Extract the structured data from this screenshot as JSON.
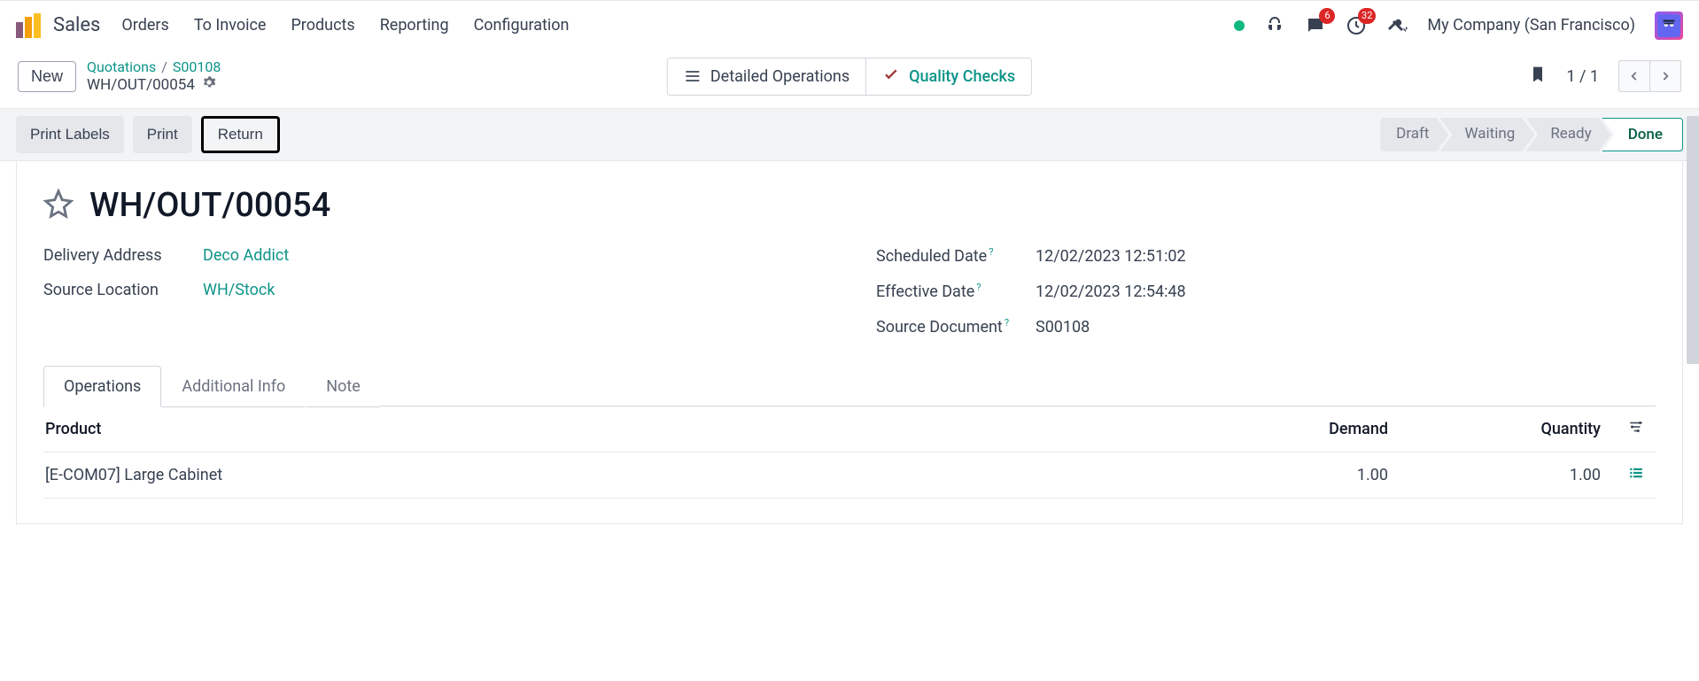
{
  "app": {
    "name": "Sales"
  },
  "nav": {
    "items": [
      "Orders",
      "To Invoice",
      "Products",
      "Reporting",
      "Configuration"
    ]
  },
  "header": {
    "messages_badge": "6",
    "activities_badge": "32",
    "company": "My Company (San Francisco)"
  },
  "control": {
    "new_label": "New",
    "breadcrumb": {
      "root": "Quotations",
      "sep": "/",
      "order": "S00108",
      "record": "WH/OUT/00054"
    },
    "center_buttons": {
      "detailed_ops": "Detailed Operations",
      "quality_checks": "Quality Checks"
    },
    "pager": "1 / 1"
  },
  "actions": {
    "print_labels": "Print Labels",
    "print": "Print",
    "return": "Return"
  },
  "status_steps": [
    "Draft",
    "Waiting",
    "Ready",
    "Done"
  ],
  "record": {
    "title": "WH/OUT/00054",
    "fields_left": {
      "delivery_address_label": "Delivery Address",
      "delivery_address_value": "Deco Addict",
      "source_location_label": "Source Location",
      "source_location_value": "WH/Stock"
    },
    "fields_right": {
      "scheduled_date_label": "Scheduled Date",
      "scheduled_date_value": "12/02/2023 12:51:02",
      "effective_date_label": "Effective Date",
      "effective_date_value": "12/02/2023 12:54:48",
      "source_document_label": "Source Document",
      "source_document_value": "S00108"
    }
  },
  "tabs": [
    "Operations",
    "Additional Info",
    "Note"
  ],
  "table": {
    "headers": {
      "product": "Product",
      "demand": "Demand",
      "quantity": "Quantity"
    },
    "rows": [
      {
        "product": "[E-COM07] Large Cabinet",
        "demand": "1.00",
        "quantity": "1.00"
      }
    ]
  }
}
